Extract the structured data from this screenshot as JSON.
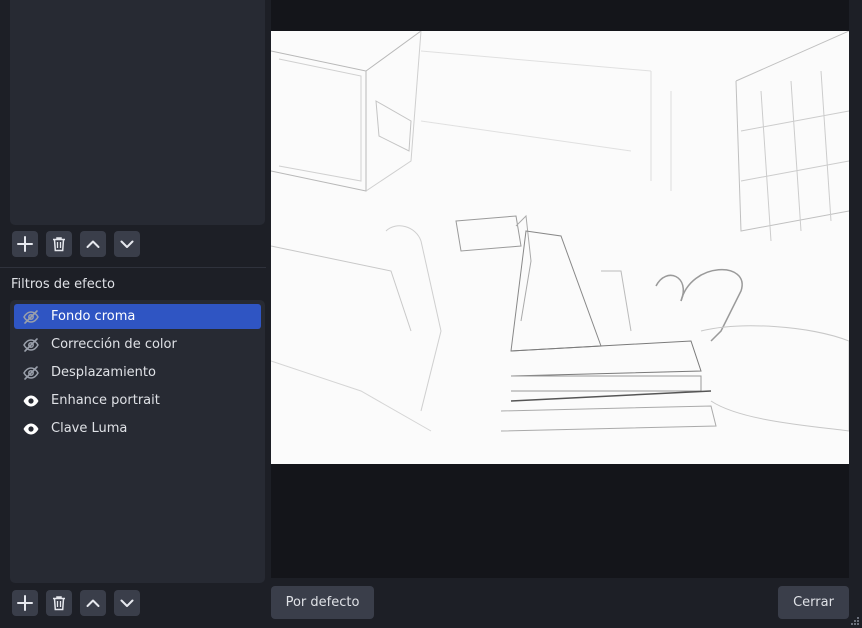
{
  "filters_section": {
    "title": "Filtros de efecto",
    "items": [
      {
        "label": "Fondo croma",
        "visible": false,
        "selected": true
      },
      {
        "label": "Corrección de color",
        "visible": false,
        "selected": false
      },
      {
        "label": "Desplazamiento",
        "visible": false,
        "selected": false
      },
      {
        "label": "Enhance portrait",
        "visible": true,
        "selected": false
      },
      {
        "label": "Clave Luma",
        "visible": true,
        "selected": false
      }
    ]
  },
  "buttons": {
    "default_label": "Por defecto",
    "close_label": "Cerrar"
  },
  "icons": {
    "add": "plus-icon",
    "remove": "trash-icon",
    "up": "chevron-up-icon",
    "down": "chevron-down-icon",
    "hidden": "eye-slash-icon",
    "visible": "eye-icon"
  },
  "colors": {
    "selection": "#2f55c3",
    "panel": "#272a33",
    "background": "#1d1f26",
    "preview_bg": "#14151a"
  }
}
